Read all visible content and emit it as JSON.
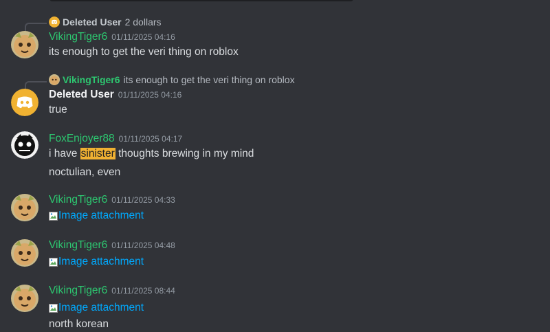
{
  "colors": {
    "background": "#313338",
    "green_user": "#2dc770",
    "link": "#00a8fc",
    "highlight": "#f0b132"
  },
  "messages": [
    {
      "reply": {
        "user": "Deleted User",
        "text": "2 dollars"
      },
      "user": "VikingTiger6",
      "time": "01/11/2025 04:16",
      "text": "its enough to get the veri thing on roblox"
    },
    {
      "reply": {
        "user": "VikingTiger6",
        "text": "its enough to get the veri thing on roblox"
      },
      "user": "Deleted User",
      "time": "01/11/2025 04:16",
      "text": "true"
    },
    {
      "user": "FoxEnjoyer88",
      "time": "01/11/2025 04:17",
      "text_before": "i have ",
      "text_highlight": "sinister",
      "text_after": " thoughts brewing in my mind",
      "text2": "noctulian, even"
    },
    {
      "user": "VikingTiger6",
      "time": "01/11/2025 04:33",
      "attachment": "Image attachment"
    },
    {
      "user": "VikingTiger6",
      "time": "01/11/2025 04:48",
      "attachment": "Image attachment"
    },
    {
      "user": "VikingTiger6",
      "time": "01/11/2025 08:44",
      "attachment": "Image attachment",
      "text_after_attachment": "north korean"
    }
  ]
}
